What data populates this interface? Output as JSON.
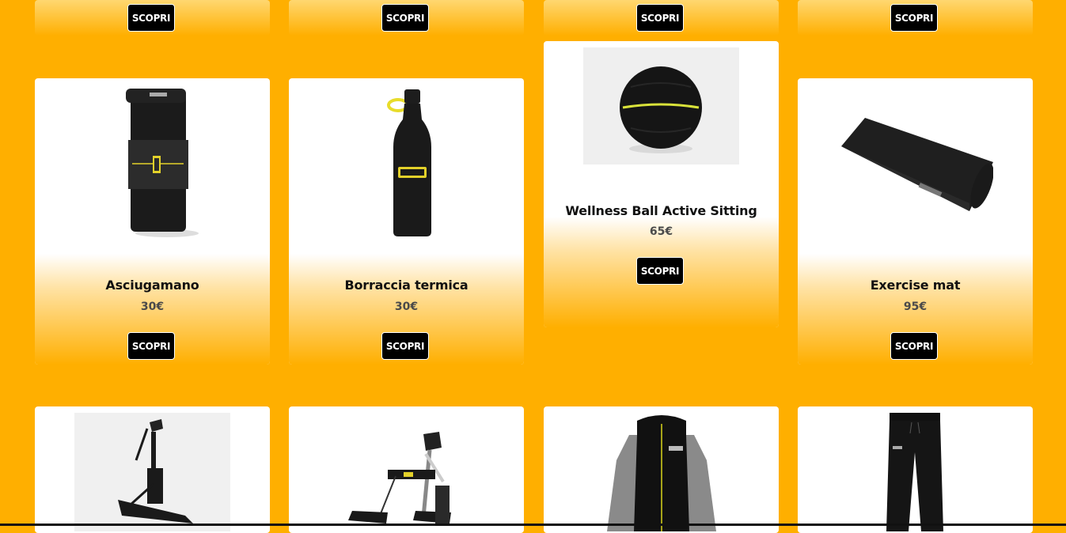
{
  "button_label": "SCOPRI",
  "colors": {
    "background": "#FFAF00",
    "card": "#FFFFFF",
    "button": "#000000"
  },
  "top_row": {
    "buttons": [
      "SCOPRI",
      "SCOPRI",
      "SCOPRI",
      "SCOPRI"
    ]
  },
  "products": [
    {
      "name": "Asciugamano",
      "price": "30€",
      "button": "SCOPRI",
      "image": "towel-image"
    },
    {
      "name": "Borraccia termica",
      "price": "30€",
      "button": "SCOPRI",
      "image": "bottle-image"
    },
    {
      "name": "Wellness Ball Active Sitting",
      "price": "65€",
      "button": "SCOPRI",
      "image": "ball-image"
    },
    {
      "name": "Exercise mat",
      "price": "95€",
      "button": "SCOPRI",
      "image": "mat-image"
    }
  ],
  "bottom_row": [
    {
      "image": "elliptical-image"
    },
    {
      "image": "crosstrainer-image"
    },
    {
      "image": "jacket-image"
    },
    {
      "image": "pants-image"
    }
  ]
}
